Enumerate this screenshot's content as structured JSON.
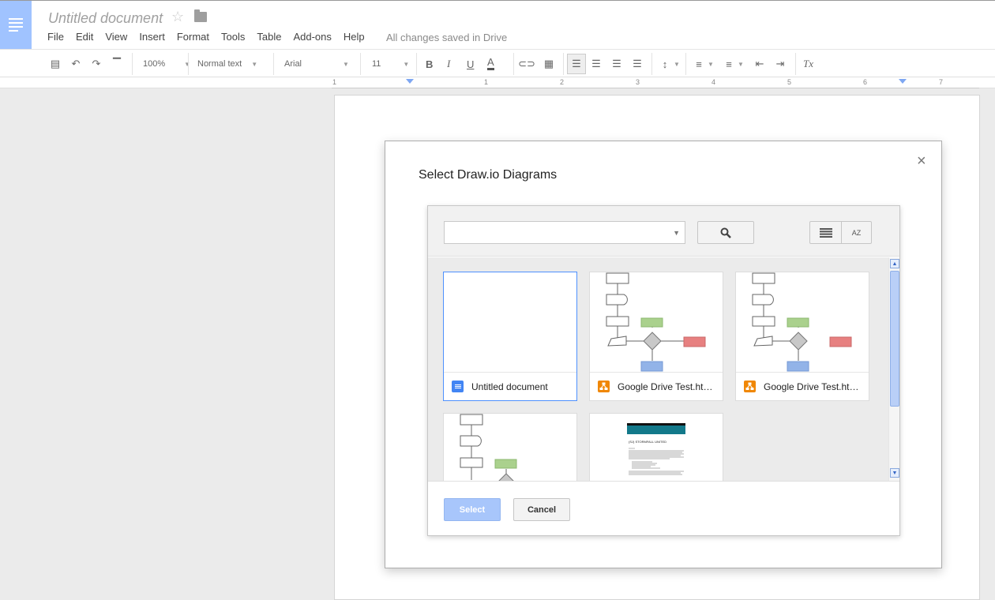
{
  "app": {
    "doc_title": "Untitled document",
    "save_status": "All changes saved in Drive",
    "accent": "#a0c3ff"
  },
  "menubar": [
    "File",
    "Edit",
    "View",
    "Insert",
    "Format",
    "Tools",
    "Table",
    "Add-ons",
    "Help"
  ],
  "toolbar": {
    "zoom": "100%",
    "style": "Normal text",
    "font": "Arial",
    "size": "11",
    "bold": "B",
    "italic": "I",
    "underline": "U",
    "text_color": "A",
    "clear_format": "Tx"
  },
  "ruler": {
    "numbers": [
      "1",
      "1",
      "2",
      "3",
      "4",
      "5",
      "6",
      "7"
    ]
  },
  "dialog": {
    "title": "Select Draw.io Diagrams",
    "close": "×",
    "search_placeholder": "",
    "sort_label": "AZ",
    "select_label": "Select",
    "cancel_label": "Cancel",
    "files": [
      {
        "name": "Untitled document",
        "type": "doc-file-icon",
        "selected": true
      },
      {
        "name": "Google Drive Test.ht…",
        "type": "drawio-file-icon",
        "selected": false
      },
      {
        "name": "Google Drive Test.ht…",
        "type": "drawio-file-icon",
        "selected": false
      },
      {
        "name": "",
        "type": "drawio-file-icon",
        "selected": false
      },
      {
        "name": "",
        "type": "doc-file-icon",
        "selected": false
      }
    ],
    "thumb_doc_heading": "(SJ) STORMFALL UNITED"
  }
}
